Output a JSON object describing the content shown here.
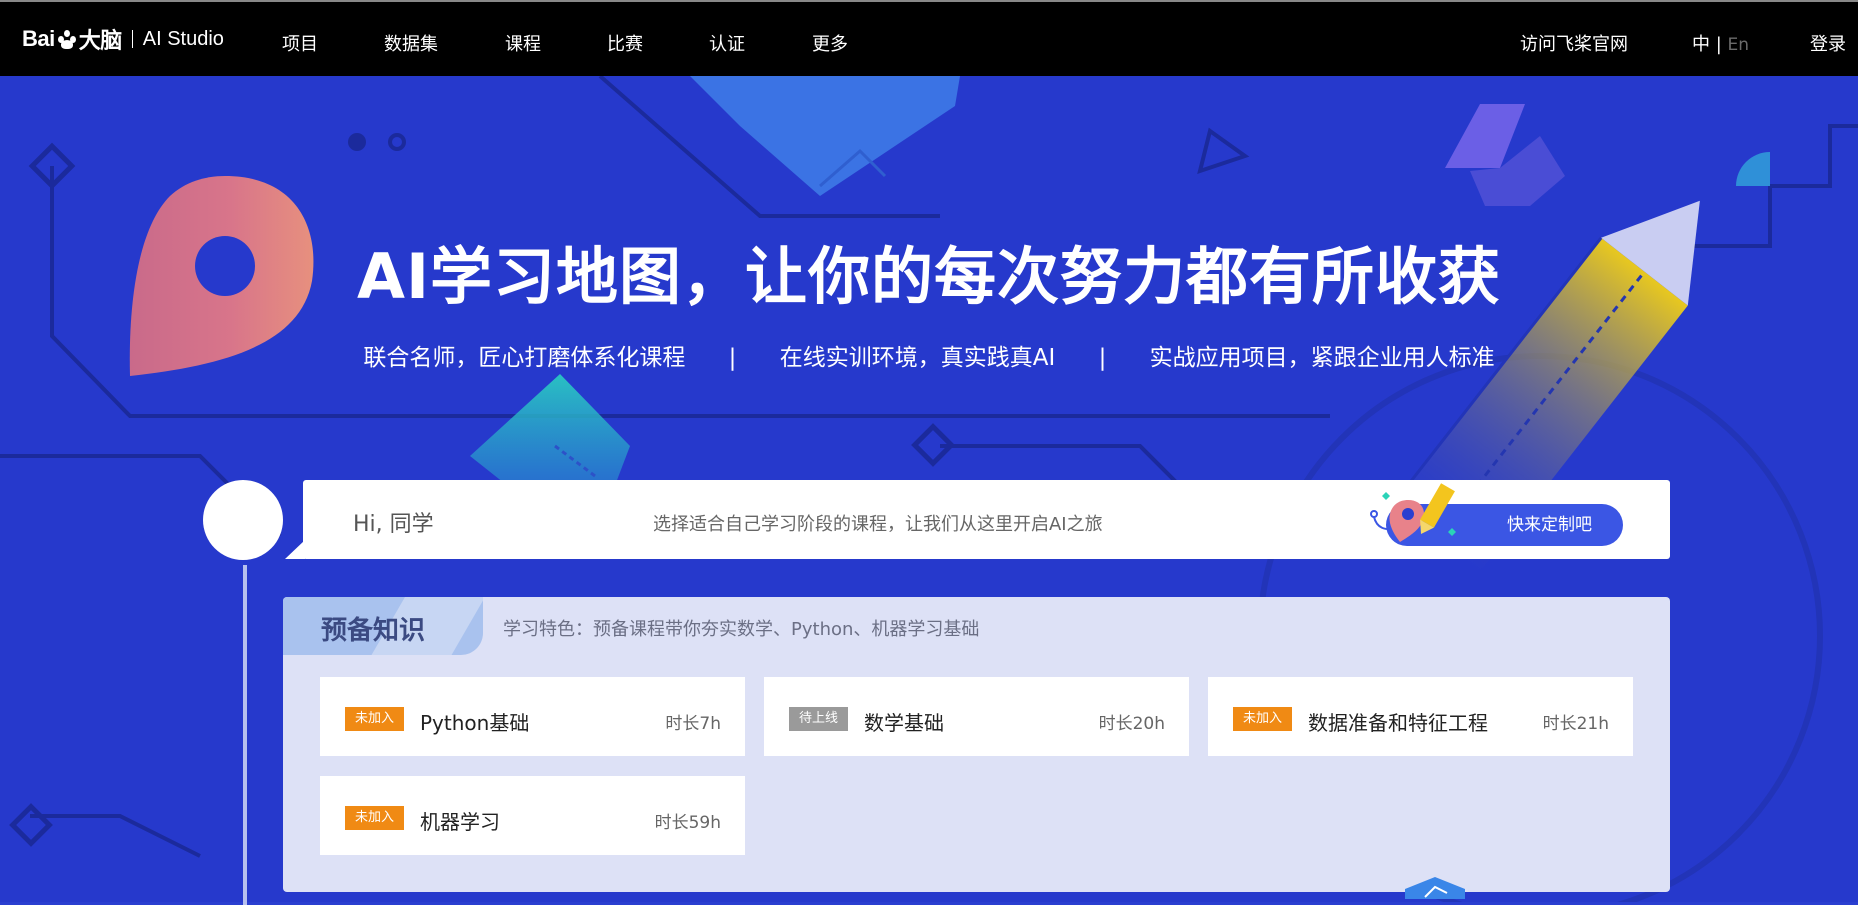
{
  "header": {
    "logo_text": "Bai",
    "logo_text_2": "大脑",
    "logo_product": "AI Studio",
    "nav": [
      {
        "label": "项目"
      },
      {
        "label": "数据集"
      },
      {
        "label": "课程"
      },
      {
        "label": "比赛"
      },
      {
        "label": "认证"
      },
      {
        "label": "更多"
      }
    ],
    "official_site": "访问飞桨官网",
    "lang_zh": "中",
    "lang_sep": "|",
    "lang_en": "En",
    "login": "登录"
  },
  "hero": {
    "title": "AI学习地图，让你的每次努力都有所收获",
    "subtitles": [
      "联合名师，匠心打磨体系化课程",
      "在线实训环境，真实践真AI",
      "实战应用项目，紧跟企业用人标准"
    ],
    "separator": "|"
  },
  "greeting": {
    "hi": "Hi, 同学",
    "description": "选择适合自己学习阶段的课程，让我们从这里开启AI之旅",
    "cta": "快来定制吧"
  },
  "panel": {
    "tag": "预备知识",
    "feature": "学习特色：预备课程带你夯实数学、Python、机器学习基础",
    "courses": [
      {
        "badge": "未加入",
        "name": "Python基础",
        "duration": "时长7h",
        "status": "not-joined"
      },
      {
        "badge": "待上线",
        "name": "数学基础",
        "duration": "时长20h",
        "status": "upcoming"
      },
      {
        "badge": "未加入",
        "name": "数据准备和特征工程",
        "duration": "时长21h",
        "status": "not-joined"
      },
      {
        "badge": "未加入",
        "name": "机器学习",
        "duration": "时长59h",
        "status": "not-joined"
      }
    ]
  },
  "colors": {
    "hero_bg": "#2639cc",
    "topbar_bg": "#000000",
    "badge_orange": "#f08a14",
    "badge_gray": "#9a9a9a",
    "cta_blue": "#3b56e4",
    "panel_bg": "#dde1f6"
  }
}
